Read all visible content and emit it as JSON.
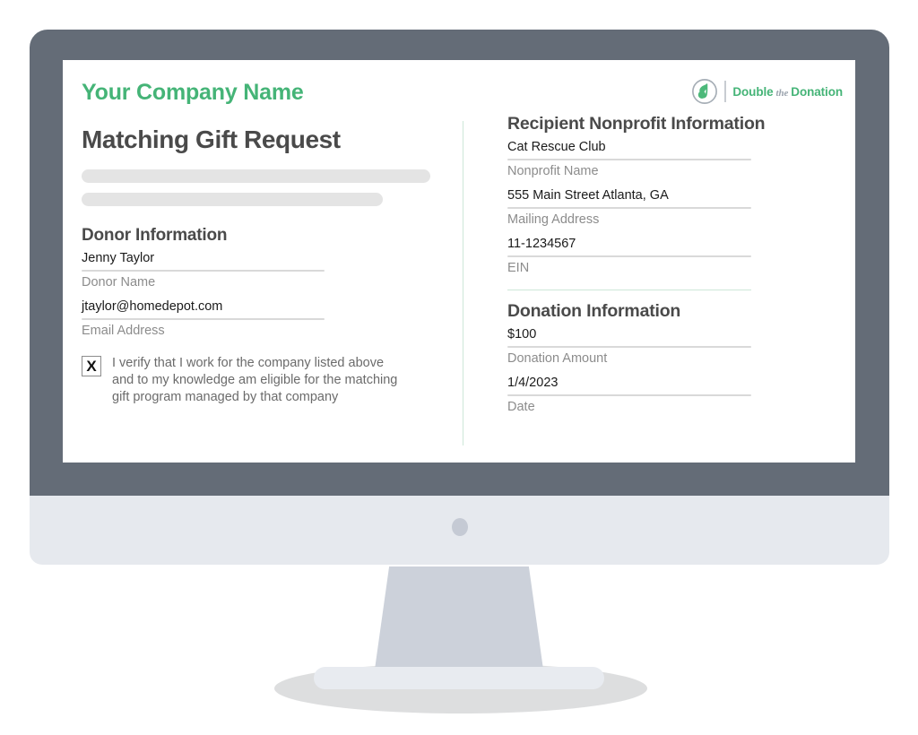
{
  "brand": {
    "company_title": "Your Company Name",
    "accent_green": "#45b477",
    "heading_gray": "#4a4a4a",
    "label_gray": "#8c8c8c"
  },
  "logo": {
    "icon": "double-the-donation-leaf-icon",
    "word_one": "Double",
    "word_two": "the",
    "word_three": "Donation"
  },
  "document": {
    "title": "Matching Gift Request",
    "placeholder_lines": 2
  },
  "donor_section": {
    "heading": "Donor Information",
    "fields": [
      {
        "value": "Jenny Taylor",
        "label": "Donor Name"
      },
      {
        "value": "jtaylor@homedepot.com",
        "label": "Email Address"
      }
    ],
    "verification": {
      "checkbox_mark": "X",
      "checked": true,
      "text": "I verify that I work for the company listed above and to my knowledge am eligible for the matching gift program managed by that company"
    }
  },
  "nonprofit_section": {
    "heading": "Recipient Nonprofit Information",
    "fields": [
      {
        "value": "Cat Rescue Club",
        "label": "Nonprofit Name"
      },
      {
        "value": "555 Main Street Atlanta, GA",
        "label": "Mailing Address"
      },
      {
        "value": "11-1234567",
        "label": "EIN"
      }
    ]
  },
  "donation_section": {
    "heading": "Donation Information",
    "fields": [
      {
        "value": "$100",
        "label": "Donation Amount"
      },
      {
        "value": "1/4/2023",
        "label": "Date"
      }
    ]
  },
  "device": {
    "type": "desktop-monitor",
    "bezel_color": "#646c77",
    "chin_color": "#e6e9ee",
    "stand_color": "#ccd1da",
    "foot_color": "#e8ebf0",
    "shadow_color": "#d7d8d9"
  }
}
